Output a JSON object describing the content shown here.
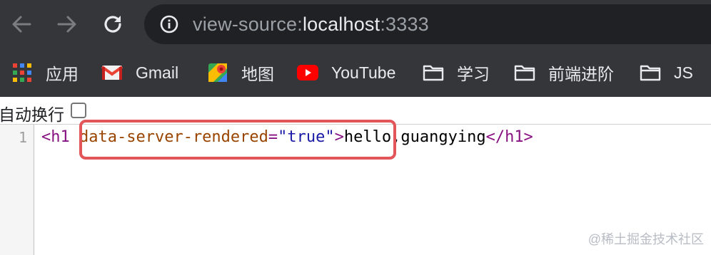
{
  "toolbar": {
    "back_icon": "arrow-left-icon",
    "forward_icon": "arrow-right-icon",
    "reload_icon": "reload-icon",
    "info_icon": "info-icon",
    "url_scheme": "view-source:",
    "url_host": "localhost",
    "url_port": ":3333"
  },
  "bookmarks": [
    {
      "label": "应用",
      "icon": "apps-grid-icon"
    },
    {
      "label": "Gmail",
      "icon": "gmail-icon"
    },
    {
      "label": "地图",
      "icon": "maps-icon"
    },
    {
      "label": "YouTube",
      "icon": "youtube-icon"
    },
    {
      "label": "学习",
      "icon": "folder-icon"
    },
    {
      "label": "前端进阶",
      "icon": "folder-icon"
    },
    {
      "label": "JS",
      "icon": "folder-icon"
    }
  ],
  "line_wrap": {
    "label": "自动换行",
    "checked": false
  },
  "source": {
    "line_number": "1",
    "open_tag": "<h1",
    "attr_name": "data-server-rendered",
    "attr_eq": "=",
    "attr_value": "\"true\"",
    "open_tag_close": ">",
    "text": "hello,guangying",
    "close_tag": "</h1>"
  },
  "watermark": "@稀土掘金技术社区",
  "colors": {
    "chrome_dark": "#35363a",
    "omnibox": "#202124",
    "highlight": "#e25558",
    "tag": "#881280",
    "attr_name": "#994500",
    "attr_value": "#1a1aa6"
  }
}
